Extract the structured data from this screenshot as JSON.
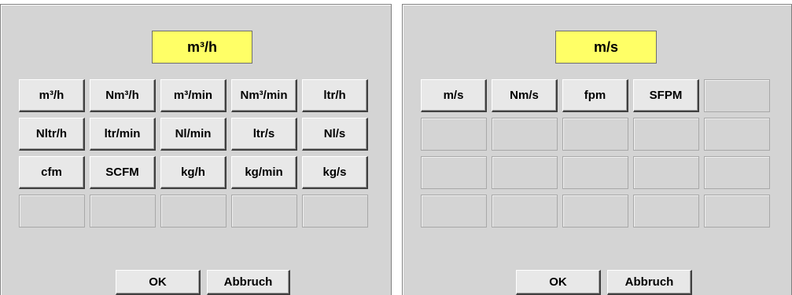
{
  "left_panel": {
    "title": "m³/h",
    "rows": [
      [
        "m³/h",
        "Nm³/h",
        "m³/min",
        "Nm³/min",
        "ltr/h"
      ],
      [
        "Nltr/h",
        "ltr/min",
        "Nl/min",
        "ltr/s",
        "Nl/s"
      ],
      [
        "cfm",
        "SCFM",
        "kg/h",
        "kg/min",
        "kg/s"
      ],
      [
        "",
        "",
        "",
        "",
        ""
      ]
    ],
    "ok_label": "OK",
    "cancel_label": "Abbruch"
  },
  "right_panel": {
    "title": "m/s",
    "rows": [
      [
        "m/s",
        "Nm/s",
        "fpm",
        "SFPM",
        ""
      ],
      [
        "",
        "",
        "",
        "",
        ""
      ],
      [
        "",
        "",
        "",
        "",
        ""
      ],
      [
        "",
        "",
        "",
        "",
        ""
      ]
    ],
    "ok_label": "OK",
    "cancel_label": "Abbruch"
  },
  "colors": {
    "title_background": "#ffff66",
    "panel_background": "#d4d4d4"
  }
}
